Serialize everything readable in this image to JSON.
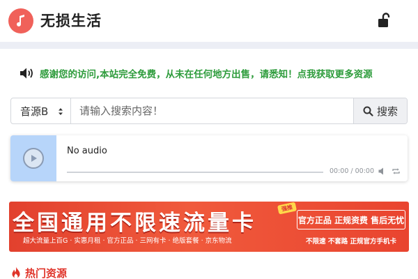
{
  "header": {
    "site_title": "无损生活",
    "logo_icon": "music-note-icon",
    "lock_icon": "unlock-icon"
  },
  "notice": {
    "icon": "speaker-icon",
    "text": "感谢您的访问,本站完全免费，从未在任何地方出售，请悉知！点我获取更多资源",
    "color": "#2e9c3c"
  },
  "search": {
    "source_value": "音源B",
    "placeholder": "请输入搜索内容！",
    "button_label": "搜索",
    "button_icon": "search-icon"
  },
  "player": {
    "track_title": "No audio",
    "time_display": "00:00 / 00:00",
    "progress": 0,
    "cover_color": "#b7d5fa"
  },
  "banner": {
    "headline": "全国通用不限速流量卡",
    "tag": "强推",
    "subline": "超大流量上百G · 实惠月租 · 官方正品 · 三网有卡 · 绝版套餐 · 京东物流",
    "right_top": "官方正品 正规资费 售后无忧",
    "right_bottom": "不限速  不套路  正规官方手机卡",
    "color": "#e9442f"
  },
  "hot": {
    "icon": "fire-icon",
    "title": "热门资源",
    "color": "#e0342a"
  },
  "colors": {
    "accent": "#f0615a",
    "band": "#eceef5"
  }
}
